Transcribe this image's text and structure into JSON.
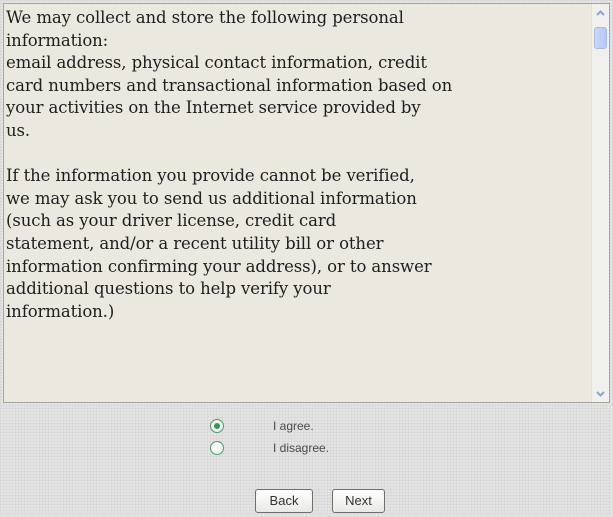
{
  "agreement": {
    "text": "We may collect and store the following personal\ninformation:\nemail address, physical contact information, credit\ncard numbers and transactional information based on\nyour activities on the Internet service provided by\nus.\n\nIf the information you provide cannot be verified,\nwe may ask you to send us additional information\n(such as your driver license, credit card\nstatement, and/or a recent utility bill or other\ninformation confirming your address), or to answer\nadditional questions to help verify your\ninformation.)"
  },
  "options": {
    "agree_label": "I agree.",
    "disagree_label": "I disagree.",
    "selected": "agree"
  },
  "buttons": {
    "back_label": "Back",
    "next_label": "Next"
  },
  "icons": {
    "scroll_up": "chevron-up-icon",
    "scroll_down": "chevron-down-icon"
  },
  "colors": {
    "textbox_background": "#ebe8e0",
    "radio_border": "#4a9b6e",
    "radio_dot": "#2f9a55",
    "scroll_thumb": "#c9d8fb",
    "scroll_arrow": "#8aa4d8"
  }
}
